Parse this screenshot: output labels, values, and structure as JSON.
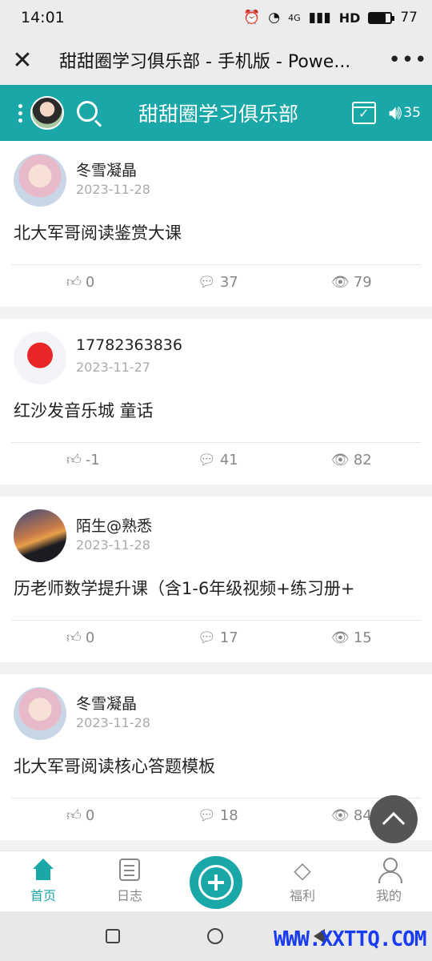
{
  "status_bar": {
    "time": "14:01",
    "network": "4G",
    "hd": "HD",
    "battery": "77"
  },
  "browser": {
    "title": "甜甜圈学习俱乐部 - 手机版 - Powe..."
  },
  "header": {
    "title": "甜甜圈学习俱乐部",
    "speaker_count": "35"
  },
  "posts": [
    {
      "user": "冬雪凝晶",
      "date": "2023-11-28",
      "title": "北大军哥阅读鉴赏大课",
      "likes": "0",
      "comments": "37",
      "views": "79"
    },
    {
      "user": "17782363836",
      "date": "2023-11-27",
      "title": "红沙发音乐城 童话",
      "likes": "-1",
      "comments": "41",
      "views": "82"
    },
    {
      "user": "陌生@熟悉",
      "date": "2023-11-28",
      "title": "历老师数学提升课（含1-6年级视频+练习册+",
      "likes": "0",
      "comments": "17",
      "views": "15"
    },
    {
      "user": "冬雪凝晶",
      "date": "2023-11-28",
      "title": "北大军哥阅读核心答题模板",
      "likes": "0",
      "comments": "18",
      "views": "84"
    }
  ],
  "nav": {
    "home": "首页",
    "log": "日志",
    "welfare": "福利",
    "mine": "我的"
  },
  "watermark": "WWW.XXTTQ.COM",
  "colors": {
    "accent": "#1aa7a7"
  }
}
